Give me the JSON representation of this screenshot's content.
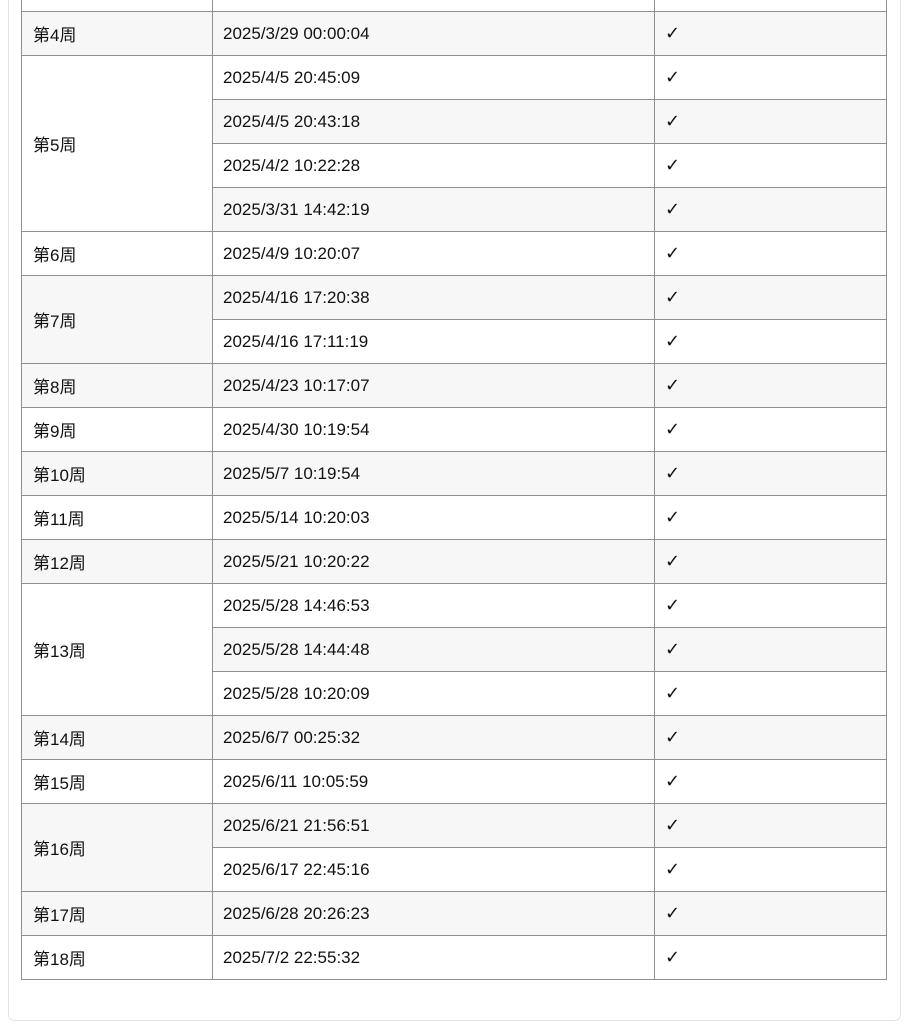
{
  "check_mark": "✓",
  "weeks": [
    {
      "label": "",
      "times": [
        ""
      ]
    },
    {
      "label": "第4周",
      "times": [
        "2025/3/29 00:00:04"
      ]
    },
    {
      "label": "第5周",
      "times": [
        "2025/4/5 20:45:09",
        "2025/4/5 20:43:18",
        "2025/4/2 10:22:28",
        "2025/3/31 14:42:19"
      ]
    },
    {
      "label": "第6周",
      "times": [
        "2025/4/9 10:20:07"
      ]
    },
    {
      "label": "第7周",
      "times": [
        "2025/4/16 17:20:38",
        "2025/4/16 17:11:19"
      ]
    },
    {
      "label": "第8周",
      "times": [
        "2025/4/23 10:17:07"
      ]
    },
    {
      "label": "第9周",
      "times": [
        "2025/4/30 10:19:54"
      ]
    },
    {
      "label": "第10周",
      "times": [
        "2025/5/7 10:19:54"
      ]
    },
    {
      "label": "第11周",
      "times": [
        "2025/5/14 10:20:03"
      ]
    },
    {
      "label": "第12周",
      "times": [
        "2025/5/21 10:20:22"
      ]
    },
    {
      "label": "第13周",
      "times": [
        "2025/5/28 14:46:53",
        "2025/5/28 14:44:48",
        "2025/5/28 10:20:09"
      ]
    },
    {
      "label": "第14周",
      "times": [
        "2025/6/7 00:25:32"
      ]
    },
    {
      "label": "第15周",
      "times": [
        "2025/6/11 10:05:59"
      ]
    },
    {
      "label": "第16周",
      "times": [
        "2025/6/21 21:56:51",
        "2025/6/17 22:45:16"
      ]
    },
    {
      "label": "第17周",
      "times": [
        "2025/6/28 20:26:23"
      ]
    },
    {
      "label": "第18周",
      "times": [
        "2025/7/2 22:55:32"
      ]
    }
  ]
}
